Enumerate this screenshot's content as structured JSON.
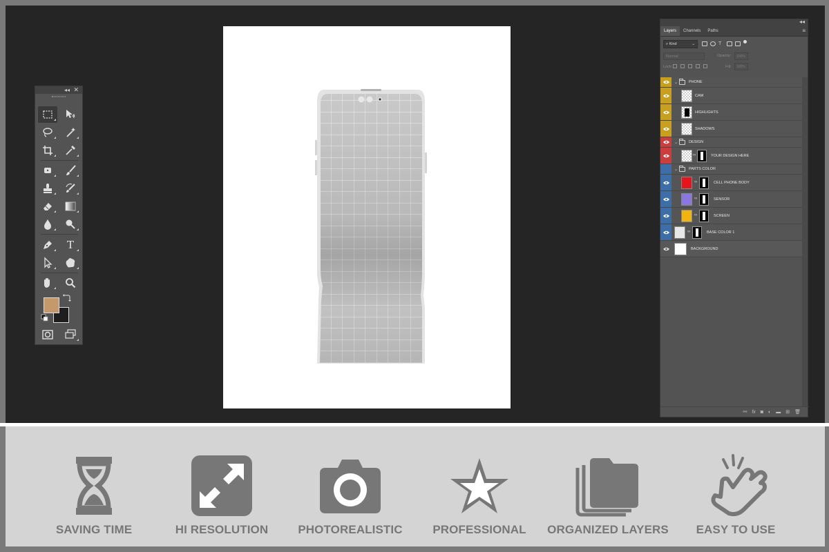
{
  "colors": {
    "foreground_swatch": "#c49a6c",
    "background_swatch": "#1e1e1e",
    "phone_group": "#c8a020",
    "design_group": "#cc3d3d",
    "parts_group": "#3d6ea8",
    "cell_phone_body": "#e6151b",
    "sensor": "#8a78e0",
    "screen": "#f2b50f",
    "feature_icon": "#777777"
  },
  "tools_panel": {
    "collapse_icon": "double-chevron-icon",
    "close_glyph": "✕",
    "type_tool_glyph": "T"
  },
  "layers_panel": {
    "tabs": [
      "Layers",
      "Channels",
      "Paths"
    ],
    "filter_kind": "Kind",
    "blend_mode": "Normal",
    "opacity_label": "Opacity:",
    "opacity_value": "100%",
    "lock_label": "Lock:",
    "fill_label": "Fill:",
    "fill_value": "100%",
    "layers": [
      {
        "name": "PHONE",
        "type": "group"
      },
      {
        "name": "CAM"
      },
      {
        "name": "HIGHLIGHTS"
      },
      {
        "name": "SHADOWS"
      },
      {
        "name": "DESIGN",
        "type": "group"
      },
      {
        "name": "YOUR DESIGN HERE"
      },
      {
        "name": "PARTS COLOR",
        "type": "group"
      },
      {
        "name": "CELL PHONE BODY"
      },
      {
        "name": "SENSOR"
      },
      {
        "name": "SCREEN"
      },
      {
        "name": "BASE COLOR 1"
      },
      {
        "name": "BACKGROUND"
      }
    ]
  },
  "features": [
    {
      "label": "SAVING TIME",
      "icon": "hourglass-icon"
    },
    {
      "label": "HI RESOLUTION",
      "icon": "expand-arrows-icon"
    },
    {
      "label": "PHOTOREALISTIC",
      "icon": "camera-icon"
    },
    {
      "label": "PROFESSIONAL",
      "icon": "star-icon"
    },
    {
      "label": "ORGANIZED LAYERS",
      "icon": "stacked-folders-icon"
    },
    {
      "label": "EASY TO USE",
      "icon": "tap-hand-icon"
    }
  ]
}
